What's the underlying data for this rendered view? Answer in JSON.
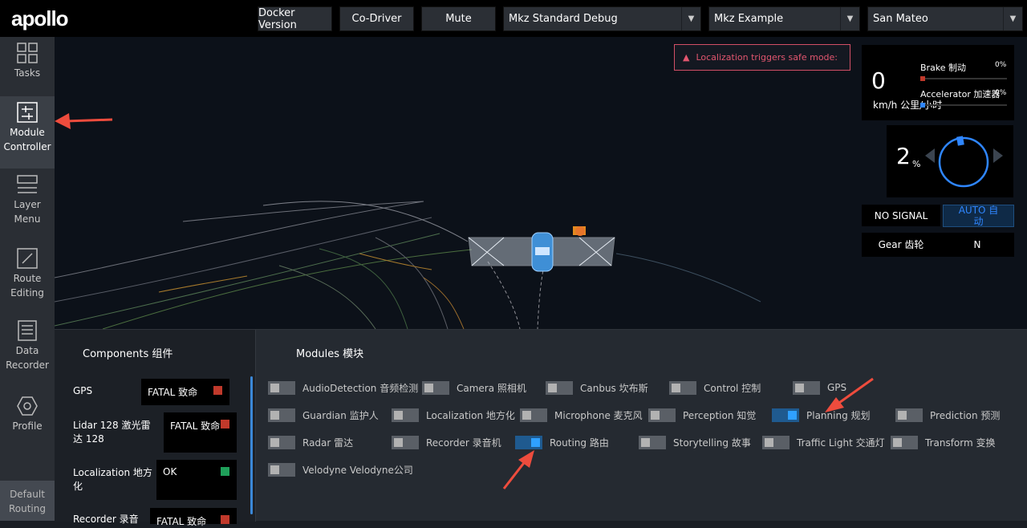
{
  "header": {
    "logo": "apollo",
    "buttons": [
      "Docker Version",
      "Co-Driver",
      "Mute"
    ],
    "selects": [
      "Mkz Standard Debug",
      "Mkz Example",
      "San Mateo"
    ]
  },
  "sidebar": {
    "items": [
      {
        "label": "Tasks"
      },
      {
        "label": "Module Controller"
      },
      {
        "label": "Layer Menu"
      },
      {
        "label": "Route Editing"
      },
      {
        "label": "Data Recorder"
      },
      {
        "label": "Profile"
      }
    ],
    "bottom": "Default Routing"
  },
  "scene": {
    "alert": "Localization triggers safe mode:",
    "speed": "0",
    "speed_unit": "km/h 公里/小时",
    "brake_label": "Brake 制动",
    "brake_pct": "0%",
    "accel_label": "Accelerator 加速器",
    "accel_pct": "0%",
    "steering": "2",
    "steering_unit": "%",
    "signal": "NO SIGNAL",
    "mode": "AUTO 自动",
    "gear_label": "Gear 齿轮",
    "gear": "N",
    "colors": {
      "brake": "#c0392b",
      "accel": "#2f86ff",
      "alert": "#e2566f"
    }
  },
  "components": {
    "title": "Components 组件",
    "items": [
      {
        "name": "GPS",
        "status": "FATAL 致命",
        "color": "#c0392b"
      },
      {
        "name": "Lidar 128 激光雷达 128",
        "status": "FATAL 致命",
        "color": "#c0392b"
      },
      {
        "name": "Localization 地方化",
        "status": "OK",
        "color": "#1fa05a"
      },
      {
        "name": "Recorder 录音",
        "status": "FATAL 致命",
        "color": "#c0392b"
      }
    ]
  },
  "modules": {
    "title": "Modules 模块",
    "items": [
      {
        "label": "AudioDetection 音频检测",
        "on": false
      },
      {
        "label": "Camera 照相机",
        "on": false
      },
      {
        "label": "Canbus 坎布斯",
        "on": false
      },
      {
        "label": "Control 控制",
        "on": false
      },
      {
        "label": "GPS",
        "on": false
      },
      {
        "label": "Guardian 监护人",
        "on": false
      },
      {
        "label": "Localization 地方化",
        "on": false
      },
      {
        "label": "Microphone 麦克风",
        "on": false
      },
      {
        "label": "Perception 知觉",
        "on": false
      },
      {
        "label": "Planning 规划",
        "on": true
      },
      {
        "label": "Prediction 预测",
        "on": false
      },
      {
        "label": "Radar 雷达",
        "on": false
      },
      {
        "label": "Recorder 录音机",
        "on": false
      },
      {
        "label": "Routing 路由",
        "on": true
      },
      {
        "label": "Storytelling 故事",
        "on": false
      },
      {
        "label": "Traffic Light 交通灯",
        "on": false
      },
      {
        "label": "Transform 变换",
        "on": false
      },
      {
        "label": "Velodyne Velodyne公司",
        "on": false
      }
    ]
  }
}
